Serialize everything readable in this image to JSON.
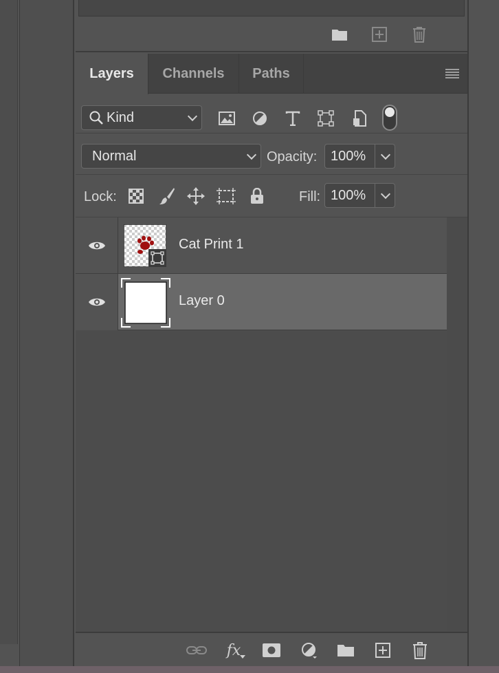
{
  "top_panel": {
    "icons": [
      "folder-icon",
      "new-item-icon",
      "trash-icon"
    ]
  },
  "tabs": [
    {
      "label": "Layers",
      "active": true
    },
    {
      "label": "Channels",
      "active": false
    },
    {
      "label": "Paths",
      "active": false
    }
  ],
  "filter": {
    "kind_label": "Kind",
    "icons": [
      "image-filter-icon",
      "adjustment-filter-icon",
      "type-filter-icon",
      "shape-filter-icon",
      "smart-object-filter-icon",
      "filter-toggle-switch"
    ]
  },
  "blend": {
    "mode": "Normal",
    "opacity_label": "Opacity:",
    "opacity_value": "100%"
  },
  "lock": {
    "label": "Lock:",
    "icons": [
      "lock-transparent-pixels-icon",
      "lock-image-pixels-icon",
      "lock-position-icon",
      "lock-artboard-icon",
      "lock-all-icon"
    ],
    "fill_label": "Fill:",
    "fill_value": "100%"
  },
  "layers": [
    {
      "name": "Cat Print 1",
      "visible": true,
      "selected": false,
      "type": "smart-object"
    },
    {
      "name": "Layer 0",
      "visible": true,
      "selected": true,
      "type": "pixel"
    }
  ],
  "footer": {
    "icons": [
      "link-layers-icon",
      "fx-icon",
      "layer-mask-icon",
      "adjustment-layer-icon",
      "group-folder-icon",
      "new-layer-icon",
      "delete-layer-icon"
    ],
    "fx_label": "fx"
  },
  "colors": {
    "panel_bg": "#535353",
    "selected_row": "#696969",
    "paw_red": "#a01010"
  }
}
